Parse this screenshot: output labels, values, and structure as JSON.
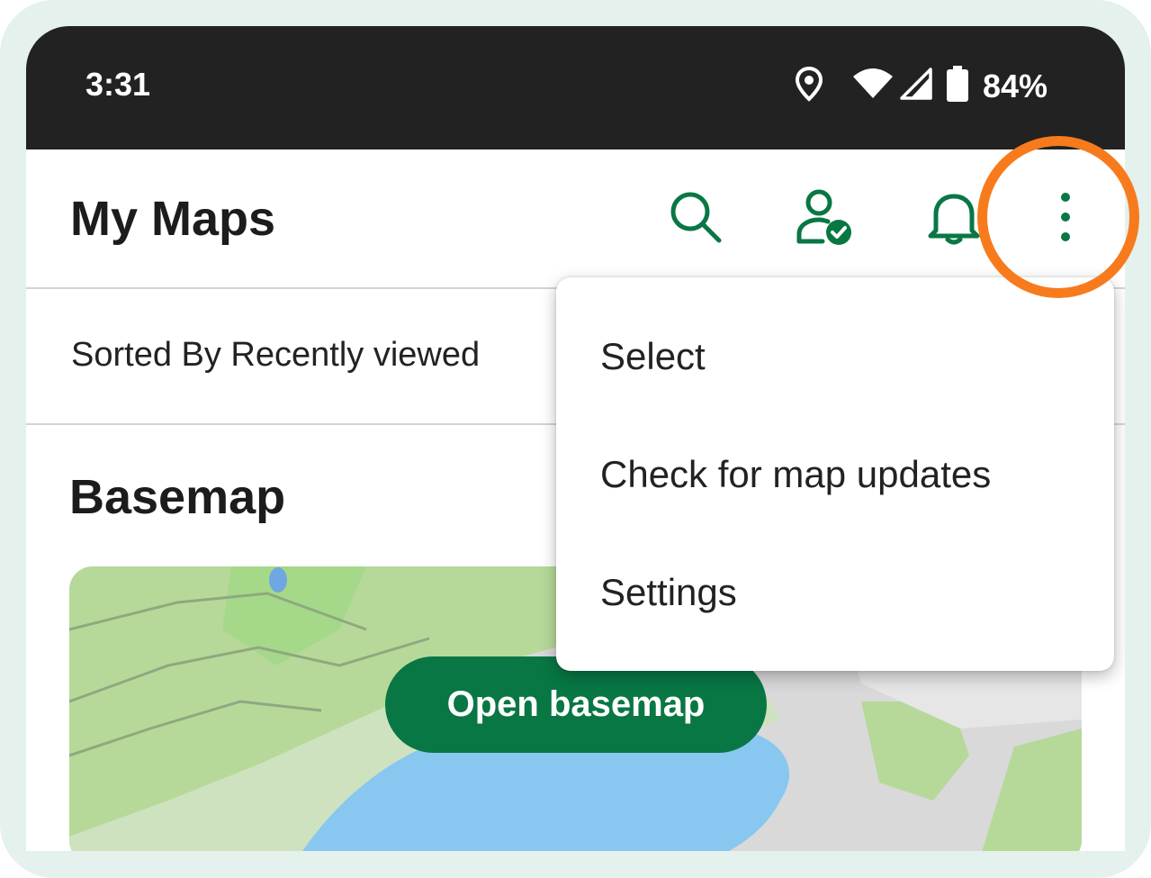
{
  "status_bar": {
    "time": "3:31",
    "battery": "84%",
    "icons": [
      "location-icon",
      "wifi-icon",
      "signal-icon",
      "battery-icon"
    ]
  },
  "app_bar": {
    "title": "My Maps",
    "actions": [
      "search-icon",
      "account-check-icon",
      "bell-icon",
      "more-vert-icon"
    ]
  },
  "sort": {
    "label": "Sorted By Recently viewed"
  },
  "section": {
    "title": "Basemap",
    "button_label": "Open basemap"
  },
  "overflow_menu": {
    "items": [
      {
        "label": "Select"
      },
      {
        "label": "Check for map updates"
      },
      {
        "label": "Settings"
      }
    ]
  },
  "colors": {
    "accent": "#087744",
    "status_bar": "#222222",
    "highlight": "#f77b1d",
    "frame": "#e4f1ec"
  }
}
